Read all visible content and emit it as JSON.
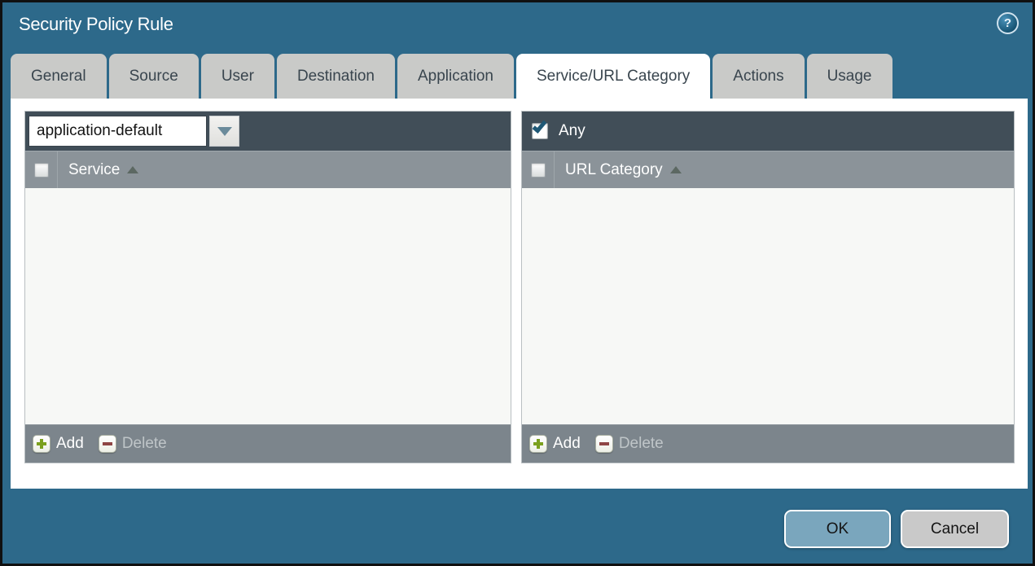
{
  "window": {
    "title": "Security Policy Rule"
  },
  "icons": {
    "help": "?",
    "dropdown_chevron": "chevron-down",
    "sort_ascending": "triangle-up",
    "add": "green-plus",
    "delete": "red-minus",
    "checked": "blue-checkmark"
  },
  "tabs": [
    {
      "label": "General",
      "active": false
    },
    {
      "label": "Source",
      "active": false
    },
    {
      "label": "User",
      "active": false
    },
    {
      "label": "Destination",
      "active": false
    },
    {
      "label": "Application",
      "active": false
    },
    {
      "label": "Service/URL Category",
      "active": true
    },
    {
      "label": "Actions",
      "active": false
    },
    {
      "label": "Usage",
      "active": false
    }
  ],
  "service_panel": {
    "dropdown_value": "application-default",
    "column_header": "Service",
    "select_all_checked": false,
    "rows": [],
    "add_label": "Add",
    "delete_label": "Delete",
    "delete_enabled": false
  },
  "url_category_panel": {
    "any_label": "Any",
    "any_checked": true,
    "column_header": "URL Category",
    "select_all_checked": false,
    "rows": [],
    "add_label": "Add",
    "delete_label": "Delete",
    "delete_enabled": false
  },
  "dialog_buttons": {
    "ok": "OK",
    "cancel": "Cancel"
  },
  "colors": {
    "background_teal": "#2d698a",
    "window_border": "#101010",
    "toolbar_dark": "#414e58",
    "header_gray": "#8b9399",
    "footer_gray": "#7c858c",
    "panel_body": "#f7f8f6",
    "active_tab": "#ffffff",
    "inactive_tab": "#c9cac8",
    "tab_text": "#39454e",
    "ok_button": "#7aa6bd",
    "cancel_button": "#c9c9c9",
    "add_green": "#7ba01e",
    "delete_red": "#8f4545",
    "check_blue": "#1f5876"
  }
}
